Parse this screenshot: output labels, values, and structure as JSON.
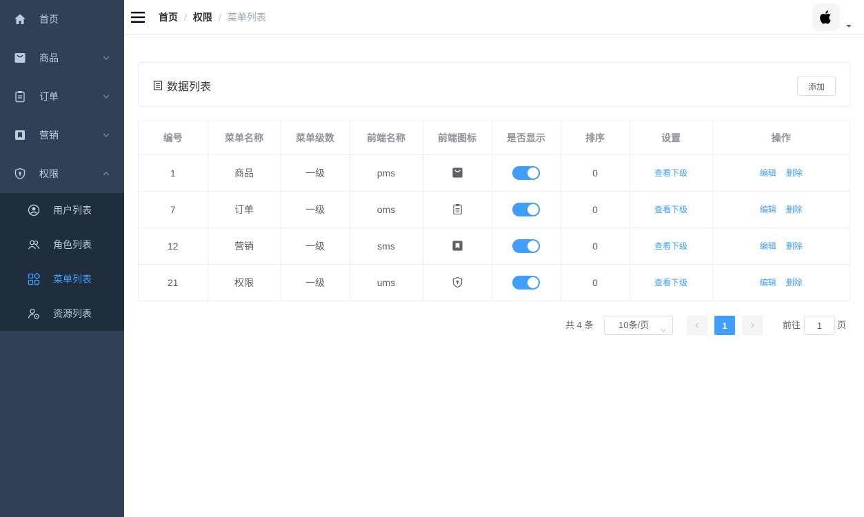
{
  "sidebar": {
    "items": [
      {
        "label": "首页",
        "icon": "home-icon"
      },
      {
        "label": "商品",
        "icon": "bag-icon",
        "arrow": "down"
      },
      {
        "label": "订单",
        "icon": "clipboard-icon",
        "arrow": "down"
      },
      {
        "label": "营销",
        "icon": "bookmark-icon",
        "arrow": "down"
      },
      {
        "label": "权限",
        "icon": "shield-icon",
        "arrow": "up"
      }
    ],
    "submenu": [
      {
        "label": "用户列表",
        "icon": "user-circle-icon"
      },
      {
        "label": "角色列表",
        "icon": "users-icon"
      },
      {
        "label": "菜单列表",
        "icon": "grid-icon",
        "active": true
      },
      {
        "label": "资源列表",
        "icon": "user-settings-icon"
      }
    ],
    "colors": {
      "bg": "#304156",
      "submenu_bg": "#1f2d3d",
      "active": "#409eff"
    }
  },
  "navbar": {
    "breadcrumb": [
      "首页",
      "权限",
      "菜单列表"
    ],
    "separator": "/"
  },
  "operate": {
    "title": "数据列表",
    "add_label": "添加"
  },
  "table": {
    "headers": [
      "编号",
      "菜单名称",
      "菜单级数",
      "前端名称",
      "前端图标",
      "是否显示",
      "排序",
      "设置",
      "操作"
    ],
    "rows": [
      {
        "id": "1",
        "name": "商品",
        "level": "一级",
        "front": "pms",
        "icon": "bag-icon",
        "show": true,
        "sort": "0",
        "setting": "查看下级",
        "edit": "编辑",
        "delete": "删除"
      },
      {
        "id": "7",
        "name": "订单",
        "level": "一级",
        "front": "oms",
        "icon": "clipboard-icon",
        "show": true,
        "sort": "0",
        "setting": "查看下级",
        "edit": "编辑",
        "delete": "删除"
      },
      {
        "id": "12",
        "name": "营销",
        "level": "一级",
        "front": "sms",
        "icon": "bookmark-icon",
        "show": true,
        "sort": "0",
        "setting": "查看下级",
        "edit": "编辑",
        "delete": "删除"
      },
      {
        "id": "21",
        "name": "权限",
        "level": "一级",
        "front": "ums",
        "icon": "shield-icon",
        "show": true,
        "sort": "0",
        "setting": "查看下级",
        "edit": "编辑",
        "delete": "删除"
      }
    ]
  },
  "pagination": {
    "total": "共 4 条",
    "page_size": "10条/页",
    "current_page": "1",
    "goto_label": "前往",
    "goto_value": "1",
    "page_suffix": "页"
  }
}
